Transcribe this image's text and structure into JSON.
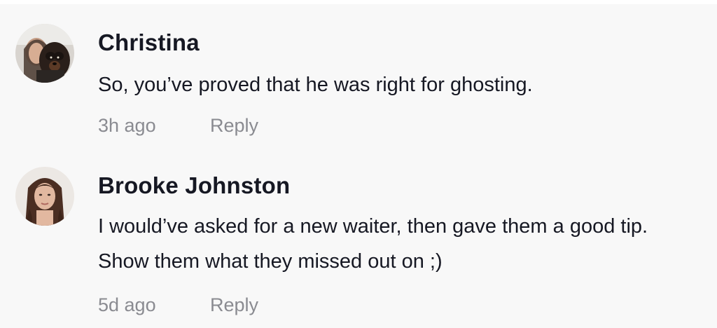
{
  "comments": [
    {
      "username": "Christina",
      "text": "So, you’ve proved that he was right for ghosting.",
      "time": "3h ago",
      "reply_label": "Reply"
    },
    {
      "username": "Brooke Johnston",
      "text": "I would’ve asked for a new waiter, then gave them a good tip. Show them what they missed out on ;)",
      "time": "5d ago",
      "reply_label": "Reply"
    }
  ],
  "colors": {
    "background": "#f8f8f8",
    "username": "#161823",
    "text": "#161823",
    "meta": "#8a8b91"
  }
}
